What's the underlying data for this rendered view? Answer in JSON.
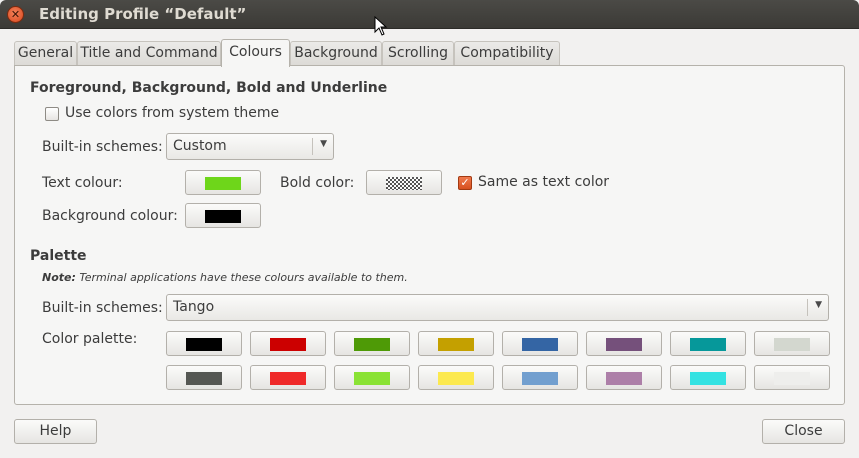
{
  "window": {
    "title": "Editing Profile “Default”"
  },
  "tabs": [
    {
      "label": "General"
    },
    {
      "label": "Title and Command"
    },
    {
      "label": "Colours"
    },
    {
      "label": "Background"
    },
    {
      "label": "Scrolling"
    },
    {
      "label": "Compatibility"
    }
  ],
  "active_tab": "Colours",
  "foreground": {
    "title": "Foreground, Background, Bold and Underline",
    "use_system_theme_label": "Use colors from system theme",
    "use_system_theme_checked": false,
    "builtin_schemes_label": "Built-in schemes:",
    "builtin_schemes_value": "Custom",
    "text_colour_label": "Text colour:",
    "text_colour": "#6ed61a",
    "bold_color_label": "Bold color:",
    "same_as_text_label": "Same as text color",
    "same_as_text_checked": true,
    "background_colour_label": "Background colour:",
    "background_colour": "#000000"
  },
  "palette": {
    "title": "Palette",
    "note_bold": "Note:",
    "note_text": " Terminal applications have these colours available to them.",
    "builtin_schemes_label": "Built-in schemes:",
    "builtin_schemes_value": "Tango",
    "color_palette_label": "Color palette:",
    "colors": [
      "#000000",
      "#cc0000",
      "#4e9a06",
      "#c4a000",
      "#3465a4",
      "#75507b",
      "#06989a",
      "#d3d7cf",
      "#555753",
      "#ef2929",
      "#8ae234",
      "#fce94f",
      "#729fcf",
      "#ad7fa8",
      "#34e2e2",
      "#eeeeec"
    ]
  },
  "footer": {
    "help_label": "Help",
    "close_label": "Close"
  },
  "icons": {
    "close": "close-icon",
    "dropdown": "chevron-down-icon",
    "cursor": "mouse-pointer-icon"
  },
  "accent": "#e05a24"
}
